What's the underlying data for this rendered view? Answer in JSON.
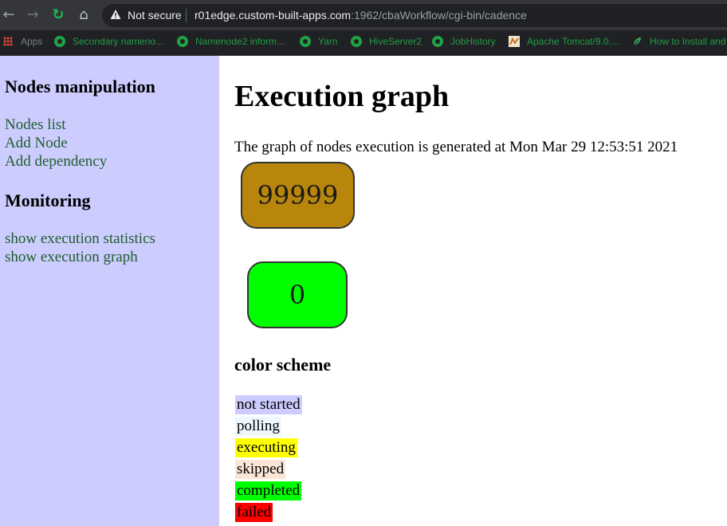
{
  "browser": {
    "security_label": "Not secure",
    "url_host": "r01edge.custom-built-apps.com",
    "url_rest": ":1962/cbaWorkflow/cgi-bin/cadence",
    "bookmarks": [
      {
        "label": "Apps"
      },
      {
        "label": "Secondary nameno..."
      },
      {
        "label": "Namenode2 inform..."
      },
      {
        "label": "Yarn"
      },
      {
        "label": "HiveServer2"
      },
      {
        "label": "JobHistory"
      },
      {
        "label": "Apache Tomcat/9.0...."
      },
      {
        "label": "How to Install and"
      }
    ]
  },
  "sidebar": {
    "nodes_heading": "Nodes manipulation",
    "nodes_links": [
      "Nodes list",
      "Add Node",
      "Add dependency"
    ],
    "monitor_heading": "Monitoring",
    "monitor_links": [
      "show execution statistics",
      "show execution graph"
    ]
  },
  "main": {
    "title": "Execution graph",
    "generated_text": "The graph of nodes execution is generated at Mon Mar 29 12:53:51 2021",
    "nodes": [
      {
        "label": "99999",
        "color": "#b8860b"
      },
      {
        "label": "0",
        "color": "#00ff00"
      }
    ],
    "scheme_title": "color scheme",
    "color_scheme": [
      {
        "label": "not started",
        "color": "#ccccff"
      },
      {
        "label": "polling",
        "color": "#f0f8ff"
      },
      {
        "label": "executing",
        "color": "#ffff00"
      },
      {
        "label": "skipped",
        "color": "#fae6d7"
      },
      {
        "label": "completed",
        "color": "#00ff00"
      },
      {
        "label": "failed",
        "color": "#ff0000"
      }
    ]
  }
}
